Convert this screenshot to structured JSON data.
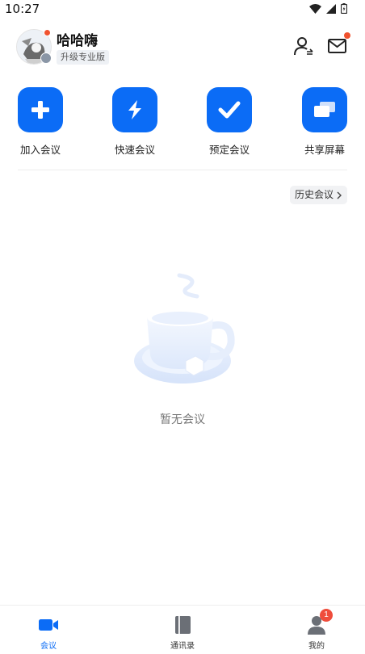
{
  "status_bar": {
    "time": "10:27"
  },
  "header": {
    "username": "哈哈嗨",
    "upgrade_label": "升级专业版"
  },
  "actions": [
    {
      "label": "加入会议",
      "icon": "plus-icon"
    },
    {
      "label": "快速会议",
      "icon": "lightning-icon"
    },
    {
      "label": "预定会议",
      "icon": "check-icon"
    },
    {
      "label": "共享屏幕",
      "icon": "screen-share-icon"
    }
  ],
  "history": {
    "label": "历史会议"
  },
  "empty_state": {
    "text": "暂无会议",
    "icon": "coffee-cup-icon"
  },
  "bottom_nav": {
    "items": [
      {
        "label": "会议",
        "icon": "video-icon",
        "active": true
      },
      {
        "label": "通讯录",
        "icon": "book-icon",
        "active": false
      },
      {
        "label": "我的",
        "icon": "person-icon",
        "active": false,
        "badge": "1"
      }
    ]
  },
  "colors": {
    "accent": "#0b6cf6",
    "badge_red": "#ef4d3c"
  }
}
